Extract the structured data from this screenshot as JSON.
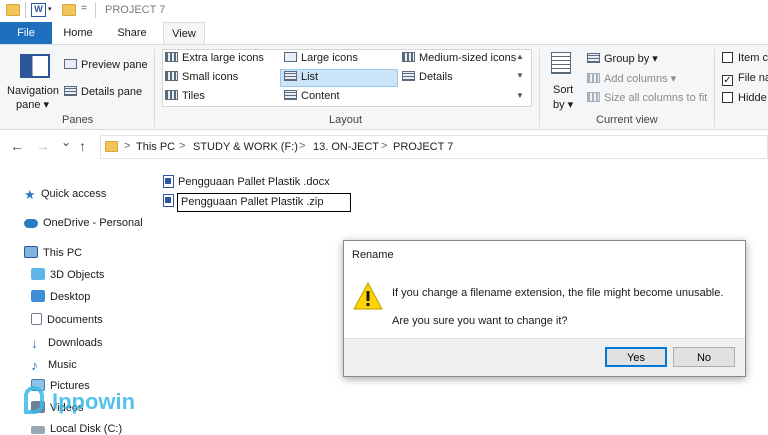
{
  "window": {
    "title": "PROJECT 7",
    "qat_dropdown": "="
  },
  "tabs": [
    {
      "label": "File"
    },
    {
      "label": "Home"
    },
    {
      "label": "Share"
    },
    {
      "label": "View"
    }
  ],
  "ribbon": {
    "panes": {
      "navigation_pane": "Navigation",
      "navigation_pane_2": "pane ▾",
      "preview_pane": "Preview pane",
      "details_pane": "Details pane",
      "group_label": "Panes"
    },
    "layout": {
      "items": [
        "Extra large icons",
        "Large icons",
        "Medium-sized icons",
        "Small icons",
        "List",
        "Details",
        "Tiles",
        "Content"
      ],
      "group_label": "Layout",
      "selected": "List"
    },
    "current_view": {
      "sort_by": "Sort",
      "sort_by_2": "by ▾",
      "group_by": "Group by ▾",
      "add_columns": "Add columns ▾",
      "size_columns": "Size all columns to fit",
      "group_label": "Current view"
    },
    "show_hide": {
      "item_checkboxes": "Item c",
      "file_name_extensions": "File na",
      "hidden_items": "Hidde"
    }
  },
  "nav": {
    "back": "←",
    "forward": "→",
    "recent": "⌄",
    "up": "↑",
    "breadcrumb": [
      "This PC",
      "STUDY & WORK (F:)",
      "13. ON-JECT",
      "PROJECT 7"
    ],
    "crumb_sep": ">"
  },
  "sidebar": {
    "items": [
      "Quick access",
      "OneDrive - Personal",
      "This PC",
      "3D Objects",
      "Desktop",
      "Documents",
      "Downloads",
      "Music",
      "Pictures",
      "Videos",
      "Local Disk (C:)"
    ]
  },
  "files": [
    {
      "name": "Pengguaan Pallet Plastik .docx"
    },
    {
      "name": "Pengguaan Pallet Plastik .zip"
    }
  ],
  "dialog": {
    "title": "Rename",
    "message1": "If you change a filename extension, the file might become unusable.",
    "message2": "Are you sure you want to change it?",
    "yes_label": "Yes",
    "no_label": "No"
  },
  "watermark": "Ippowin",
  "colors": {
    "accent": "#1f6fbf",
    "selection": "#cce4f7",
    "warning": "#ffd400"
  }
}
